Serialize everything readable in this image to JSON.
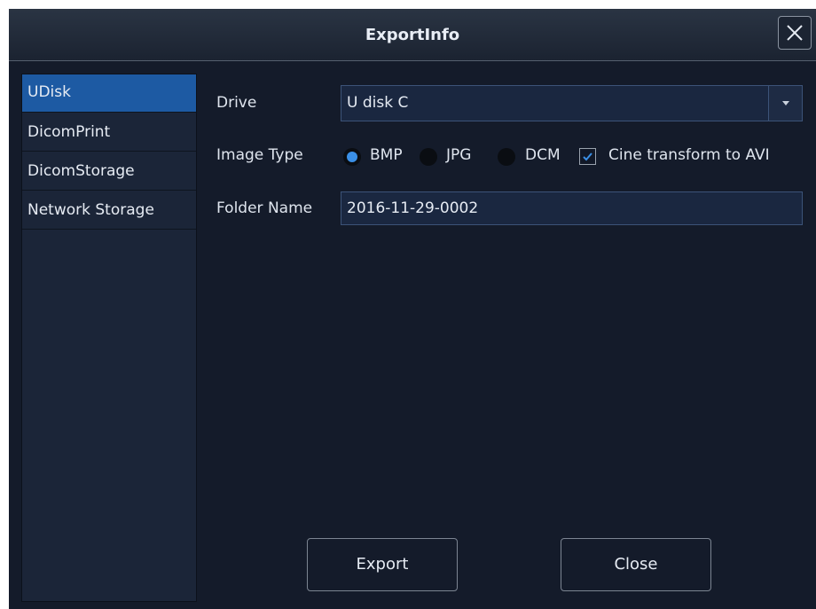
{
  "window": {
    "title": "ExportInfo"
  },
  "sidebar": {
    "items": [
      {
        "label": "UDisk",
        "active": true
      },
      {
        "label": "DicomPrint",
        "active": false
      },
      {
        "label": "DicomStorage",
        "active": false
      },
      {
        "label": "Network Storage",
        "active": false
      }
    ]
  },
  "form": {
    "drive": {
      "label": "Drive",
      "value": "U disk C"
    },
    "image_type": {
      "label": "Image Type",
      "options": [
        {
          "label": "BMP",
          "selected": true
        },
        {
          "label": "JPG",
          "selected": false
        },
        {
          "label": "DCM",
          "selected": false
        }
      ],
      "cine_checkbox": {
        "label": "Cine transform to AVI",
        "checked": true
      }
    },
    "folder_name": {
      "label": "Folder Name",
      "value": "2016-11-29-0002"
    }
  },
  "buttons": {
    "export": "Export",
    "close": "Close"
  },
  "colors": {
    "accent": "#1d5aa3",
    "radio_selected": "#3a8fe6",
    "background": "#141b2a"
  }
}
